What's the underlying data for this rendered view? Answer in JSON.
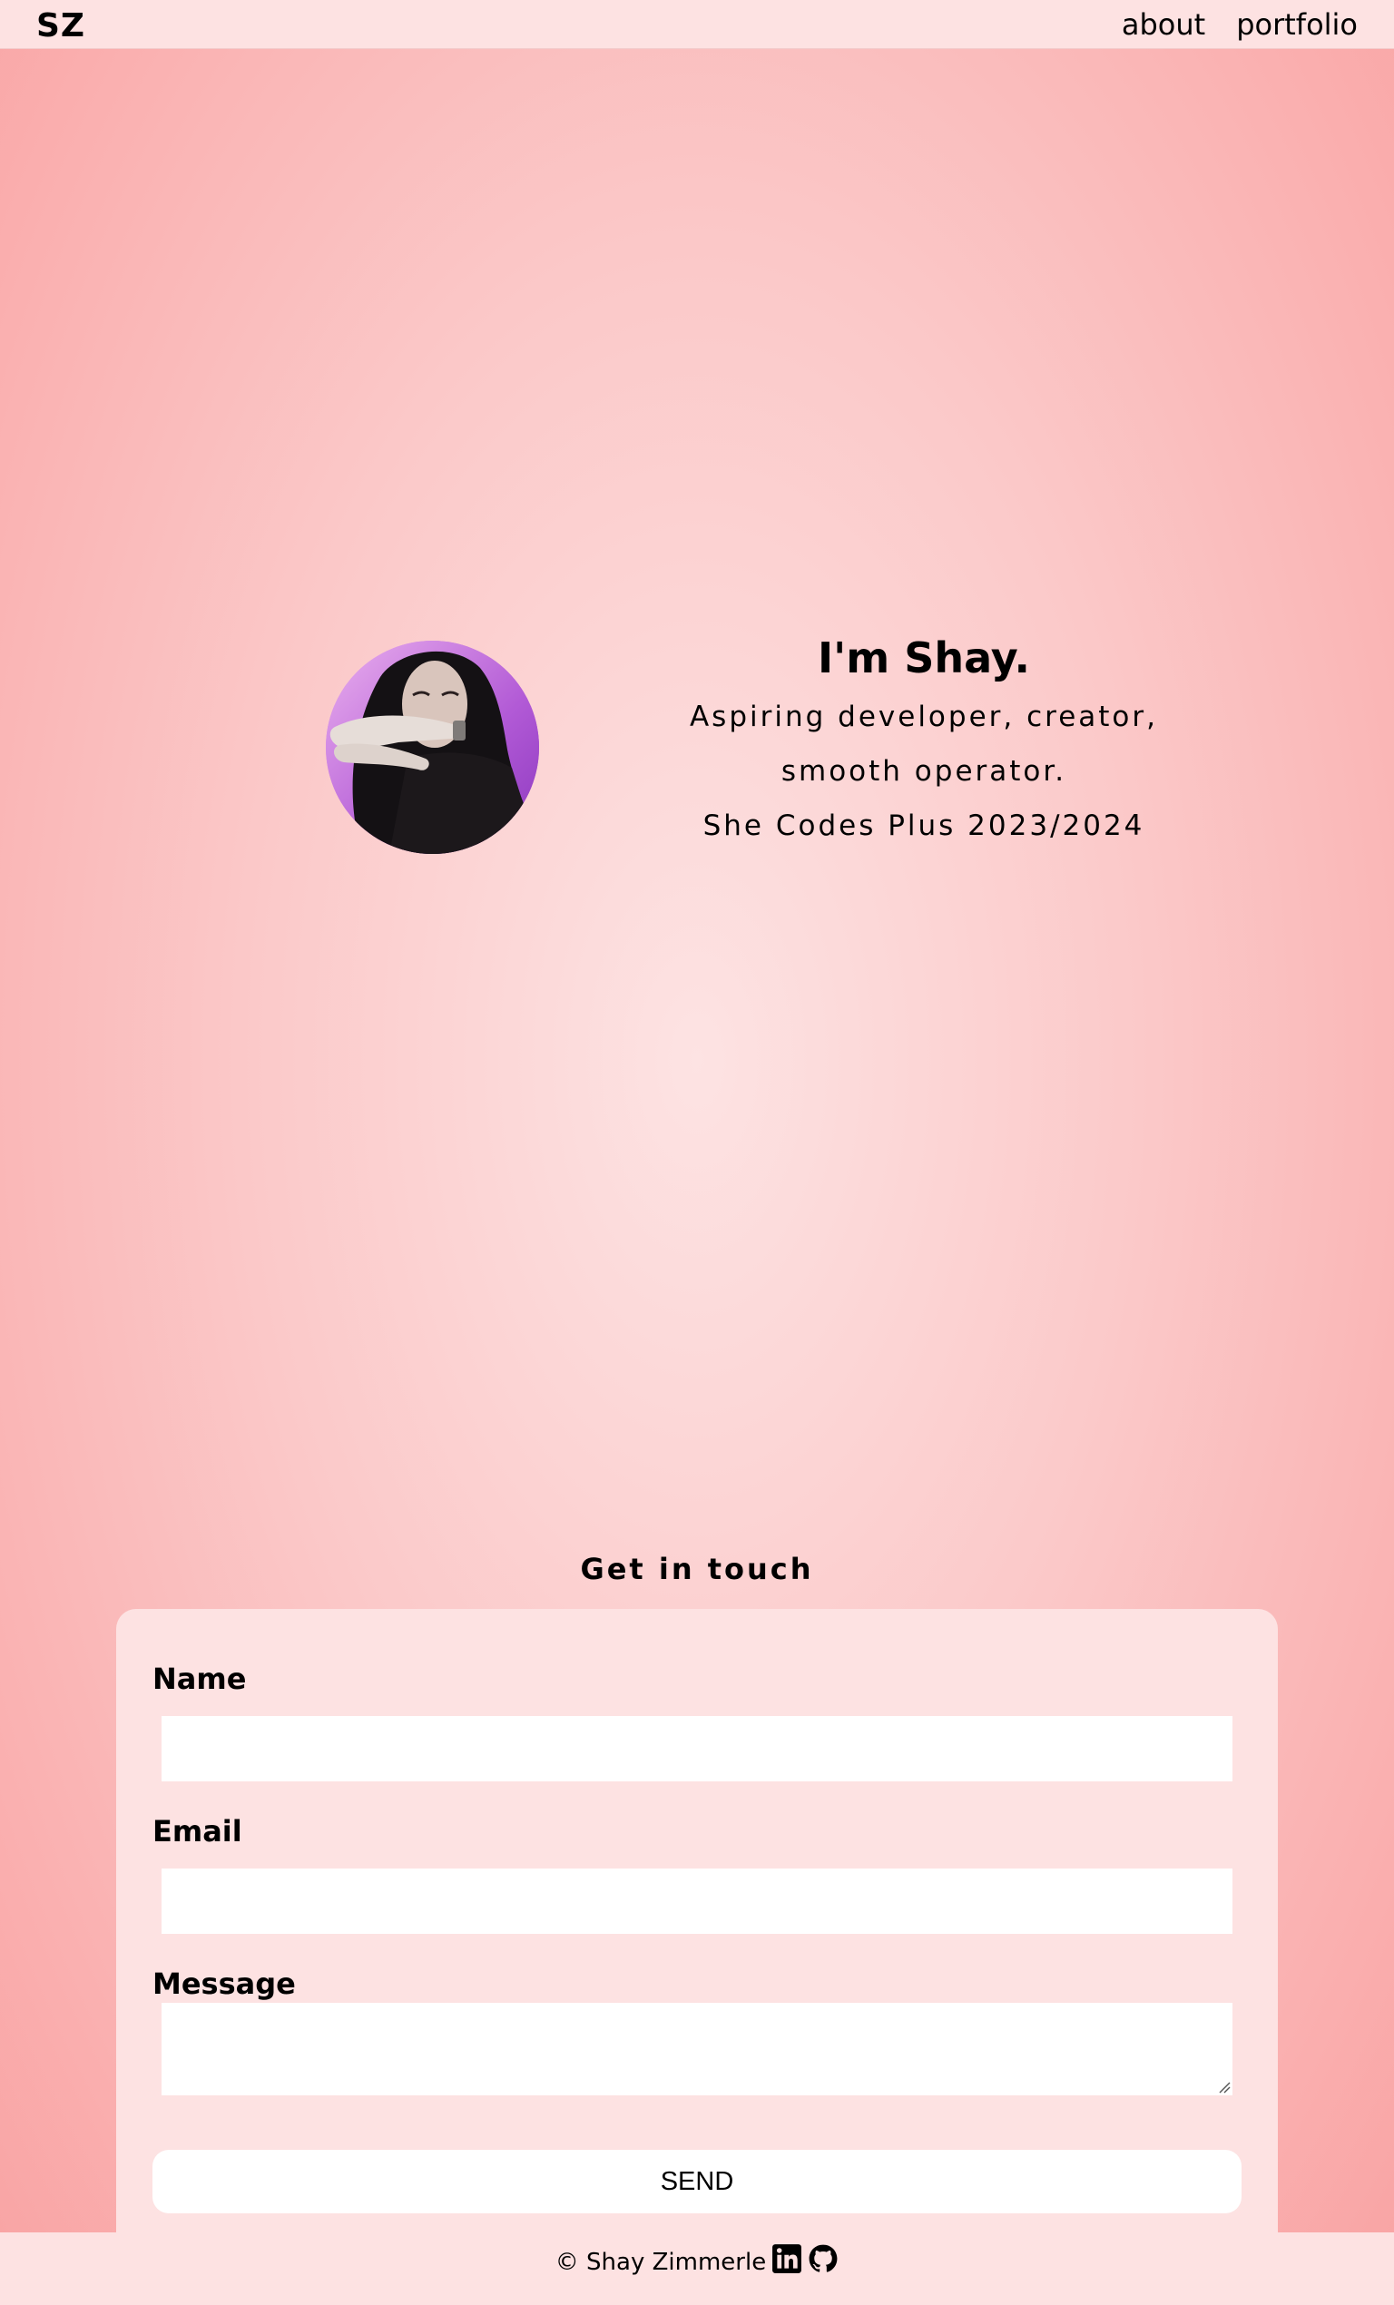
{
  "nav": {
    "brand": "SZ",
    "links": [
      {
        "label": "about"
      },
      {
        "label": "portfolio"
      }
    ]
  },
  "intro": {
    "heading": "I'm Shay.",
    "lines": [
      "Aspiring developer, creator,",
      "smooth operator.",
      "She Codes Plus 2023/2024"
    ]
  },
  "contact": {
    "title": "Get in touch",
    "name_label": "Name",
    "name_value": "",
    "email_label": "Email",
    "email_value": "",
    "message_label": "Message",
    "message_value": "",
    "send_label": "SEND"
  },
  "footer": {
    "copyright": "© Shay Zimmerle",
    "icons": [
      "linkedin-icon",
      "github-icon"
    ]
  },
  "colors": {
    "background_center": "#fde3e3",
    "background_edge": "#f9a3a3",
    "card": "#fde2e2",
    "avatar_gradient": "#b35ad6"
  }
}
